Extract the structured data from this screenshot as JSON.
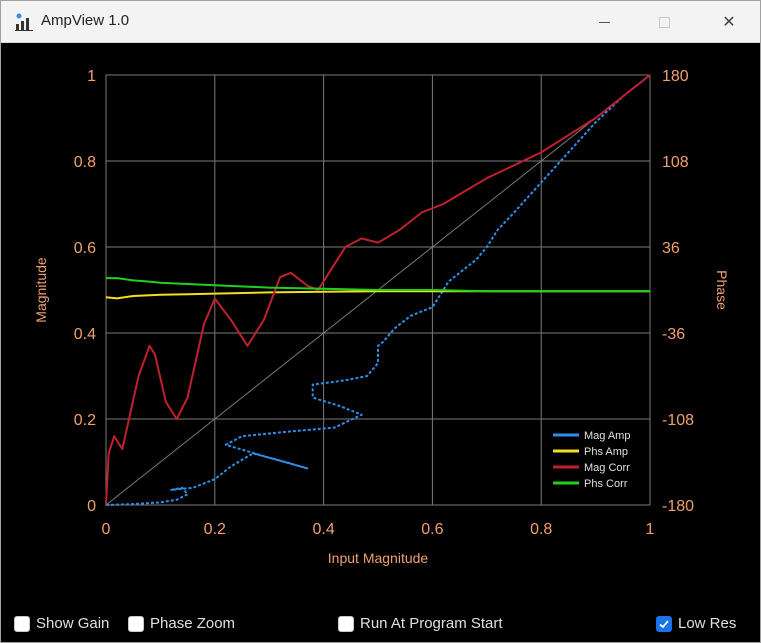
{
  "window": {
    "title": "AmpView 1.0",
    "icon": "bar-chart-app-icon"
  },
  "chart_data": {
    "type": "line",
    "xlabel": "Input Magnitude",
    "ylabel": "Magnitude",
    "y2label": "Phase",
    "xlim": [
      0,
      1
    ],
    "ylim": [
      0,
      1
    ],
    "y2lim": [
      -180,
      180
    ],
    "xticks": [
      "0",
      "0.2",
      "0.4",
      "0.6",
      "0.8",
      "1"
    ],
    "yticks": [
      "0",
      "0.2",
      "0.4",
      "0.6",
      "0.8",
      "1"
    ],
    "y2ticks": [
      "-180",
      "-108",
      "-36",
      "36",
      "108",
      "180"
    ],
    "grid": true,
    "legend_position": "bottom-right",
    "colors": {
      "background": "#000000",
      "grid": "#7a7a7a",
      "tick_text": "#f0a070",
      "label_text": "#f0a070",
      "diagonal": "#7a7a7a"
    },
    "series": [
      {
        "name": "Mag Amp",
        "color": "#2f8fe8",
        "x": [
          0,
          0.05,
          0.1,
          0.13,
          0.15,
          0.14,
          0.12,
          0.16,
          0.2,
          0.23,
          0.27,
          0.33,
          0.37,
          0.3,
          0.22,
          0.25,
          0.33,
          0.42,
          0.47,
          0.43,
          0.38,
          0.38,
          0.44,
          0.48,
          0.5,
          0.5,
          0.51,
          0.53,
          0.56,
          0.6,
          0.62,
          0.63,
          0.65,
          0.68,
          0.7,
          0.72,
          0.75,
          0.8,
          0.85,
          0.9,
          0.95,
          1.0
        ],
        "y": [
          0,
          0.002,
          0.006,
          0.012,
          0.025,
          0.04,
          0.035,
          0.04,
          0.06,
          0.09,
          0.12,
          0.1,
          0.085,
          0.11,
          0.14,
          0.16,
          0.17,
          0.18,
          0.21,
          0.23,
          0.25,
          0.28,
          0.29,
          0.3,
          0.33,
          0.37,
          0.38,
          0.41,
          0.44,
          0.46,
          0.5,
          0.52,
          0.54,
          0.57,
          0.6,
          0.64,
          0.68,
          0.75,
          0.82,
          0.89,
          0.95,
          1.0
        ]
      },
      {
        "name": "Phs Amp",
        "color": "#f0e020",
        "x": [
          0,
          0.02,
          0.05,
          0.1,
          0.15,
          0.2,
          0.3,
          0.4,
          0.5,
          0.6,
          0.7,
          0.8,
          0.9,
          1.0
        ],
        "y": [
          -6,
          -7,
          -5,
          -4,
          -3.5,
          -3,
          -2,
          -1.5,
          -1,
          -1,
          -1,
          -1,
          -1,
          -1
        ]
      },
      {
        "name": "Mag Corr",
        "color": "#c0202e",
        "x": [
          0,
          0.005,
          0.015,
          0.03,
          0.06,
          0.08,
          0.09,
          0.11,
          0.13,
          0.15,
          0.18,
          0.2,
          0.23,
          0.26,
          0.29,
          0.32,
          0.34,
          0.37,
          0.39,
          0.41,
          0.44,
          0.47,
          0.5,
          0.54,
          0.58,
          0.62,
          0.66,
          0.7,
          0.75,
          0.8,
          0.85,
          0.9,
          0.95,
          1.0
        ],
        "y": [
          0,
          0.12,
          0.16,
          0.13,
          0.3,
          0.37,
          0.35,
          0.24,
          0.2,
          0.25,
          0.42,
          0.48,
          0.43,
          0.37,
          0.43,
          0.53,
          0.54,
          0.51,
          0.5,
          0.54,
          0.6,
          0.62,
          0.61,
          0.64,
          0.68,
          0.7,
          0.73,
          0.76,
          0.79,
          0.82,
          0.86,
          0.9,
          0.95,
          1.0
        ]
      },
      {
        "name": "Phs Corr",
        "color": "#20d020",
        "x": [
          0,
          0.02,
          0.05,
          0.08,
          0.1,
          0.15,
          0.2,
          0.3,
          0.4,
          0.5,
          0.6,
          0.7,
          0.8,
          0.9,
          1.0
        ],
        "y": [
          10,
          10,
          8,
          7,
          6,
          5,
          4,
          2,
          1,
          0,
          0,
          -1,
          -1,
          -1,
          -1
        ]
      }
    ]
  },
  "controls": {
    "show_gain": {
      "label": "Show Gain",
      "checked": false
    },
    "phase_zoom": {
      "label": "Phase Zoom",
      "checked": false
    },
    "run_at_start": {
      "label": "Run At Program Start",
      "checked": false
    },
    "low_res": {
      "label": "Low Res",
      "checked": true
    }
  }
}
